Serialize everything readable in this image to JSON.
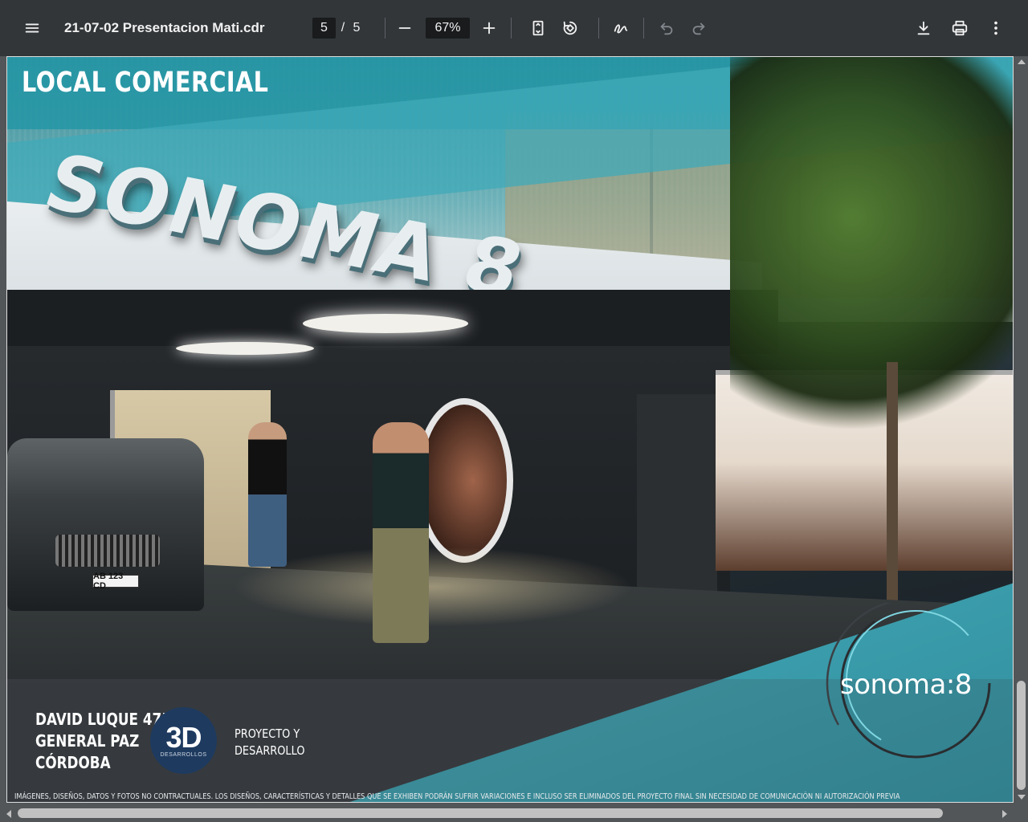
{
  "toolbar": {
    "menu_icon": "menu-icon",
    "title": "21-07-02 Presentacion Mati.cdr",
    "page_current": "5",
    "page_separator": "/",
    "page_total": "5",
    "zoom_out_icon": "minus-icon",
    "zoom_value": "67%",
    "zoom_in_icon": "plus-icon",
    "fit_icon": "fit-page-icon",
    "rotate_icon": "rotate-icon",
    "annotate_icon": "draw-icon",
    "undo_icon": "undo-icon",
    "redo_icon": "redo-icon",
    "download_icon": "download-icon",
    "print_icon": "print-icon",
    "more_icon": "more-vertical-icon"
  },
  "page": {
    "heading": "LOCAL COMERCIAL",
    "sign_text": "SONOMA 8",
    "plate": "AB 123 CD",
    "address": [
      "DAVID LUQUE 475",
      "GENERAL PAZ",
      "CÓRDOBA"
    ],
    "developer_logo_main": "3D",
    "developer_logo_sub": "DESARROLLOS",
    "developer_text": [
      "PROYECTO Y",
      "DESARROLLO"
    ],
    "brand": "sonoma:8",
    "disclaimer": "IMÁGENES, DISEÑOS, DATOS Y FOTOS NO CONTRACTUALES. LOS DISEÑOS, CARACTERÍSTICAS Y DETALLES QUE SE EXHIBEN PODRÁN SUFRIR VARIACIONES E INCLUSO SER ELIMINADOS DEL PROYECTO FINAL SIN NECESIDAD DE COMUNICACIÓN NI AUTORIZACIÓN PREVIA"
  },
  "colors": {
    "toolbar_bg": "#323639",
    "viewer_bg": "#525659",
    "teal": "#40aab8",
    "developer_logo": "#1e3a5f"
  }
}
